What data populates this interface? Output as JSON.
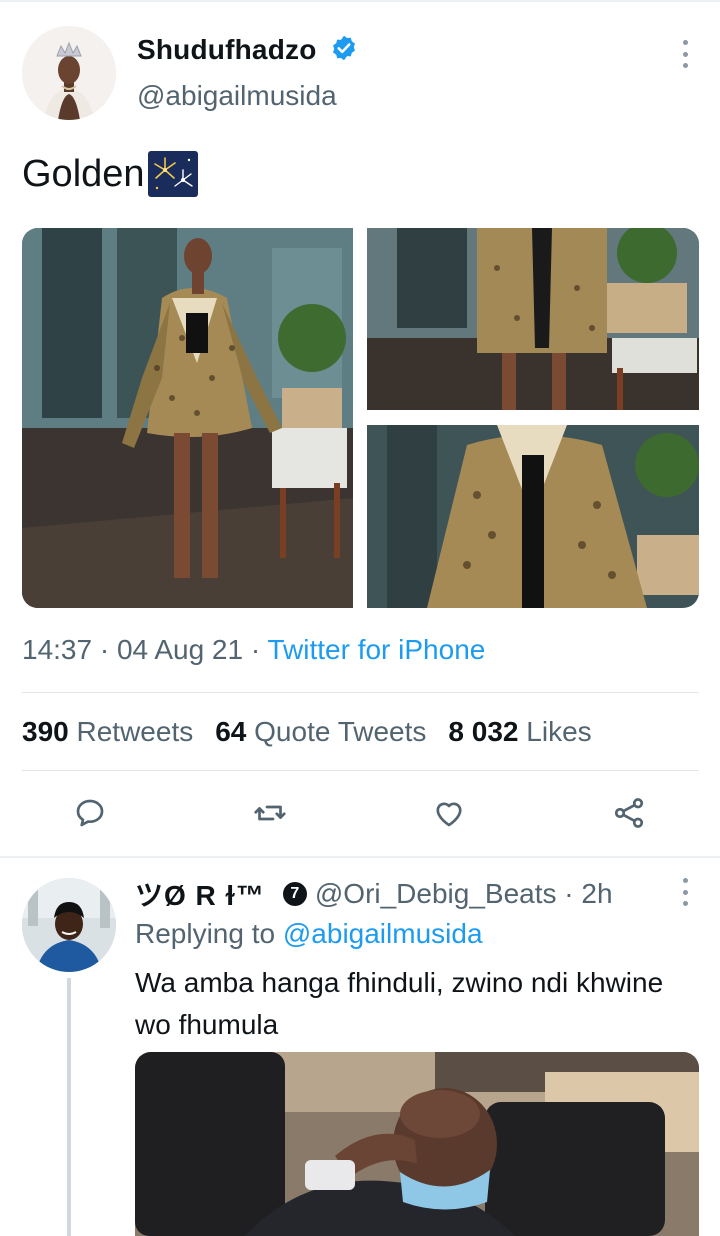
{
  "tweet": {
    "author_name": "Shudufhadzo",
    "handle": "@abigailmusida",
    "verified_icon": "verified-badge-icon",
    "text": "Golden",
    "emoji": "fireworks-emoji",
    "timestamp": "14:37 · 04 Aug 21 ·",
    "source": "Twitter for iPhone",
    "stats": {
      "retweets_count": "390",
      "retweets_label": "Retweets",
      "quotes_count": "64",
      "quotes_label": "Quote Tweets",
      "likes_count": "8 032",
      "likes_label": "Likes"
    },
    "actions": [
      "reply-icon",
      "retweet-icon",
      "like-icon",
      "share-icon"
    ]
  },
  "reply": {
    "author_name": "ツØ R ɫ™",
    "badge": "7",
    "handle_time": "@Ori_Debig_Beats · 2h",
    "replying_label": "Replying to",
    "replying_to": "@abigailmusida",
    "text": "Wa amba hanga fhinduli, zwino ndi khwine wo fhumula"
  },
  "colors": {
    "accent": "#1d9bf0",
    "text_primary": "#0f1419",
    "text_secondary": "#536471",
    "divider": "#e1e6ea"
  }
}
